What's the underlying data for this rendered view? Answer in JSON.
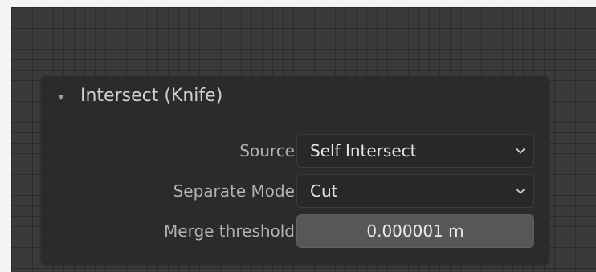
{
  "panel": {
    "title": "Intersect (Knife)",
    "collapse_icon": "triangle-down-icon",
    "expanded": true
  },
  "fields": {
    "source": {
      "label": "Source",
      "value": "Self Intersect",
      "icon": "chevron-down-icon"
    },
    "separate_mode": {
      "label": "Separate Mode",
      "value": "Cut",
      "icon": "chevron-down-icon"
    },
    "merge_threshold": {
      "label": "Merge threshold",
      "value": "0.000001 m"
    }
  },
  "colors": {
    "viewport_background": "#3a3a3a",
    "panel_background": "#2b2b2b",
    "dropdown_background": "#282828",
    "number_field_background": "#575757",
    "label_text": "#b2b2b2",
    "value_text": "#e6e6e6"
  }
}
